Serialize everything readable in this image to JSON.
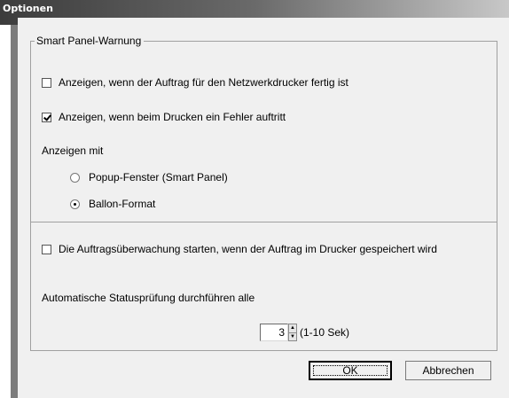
{
  "window": {
    "title": "Optionen"
  },
  "warning_group": {
    "legend": "Smart Panel-Warnung",
    "option_job_done": {
      "label": "Anzeigen, wenn der Auftrag für den Netzwerkdrucker fertig ist",
      "checked": false
    },
    "option_print_error": {
      "label": "Anzeigen, wenn beim Drucken ein Fehler auftritt",
      "checked": true
    },
    "display_with_label": "Anzeigen mit",
    "radio_popup": {
      "label": "Popup-Fenster (Smart Panel)",
      "selected": false
    },
    "radio_balloon": {
      "label": "Ballon-Format",
      "selected": true
    }
  },
  "monitoring_group": {
    "option_start_monitoring": {
      "label": "Die Auftragsüberwachung starten, wenn der Auftrag im Drucker gespeichert wird",
      "checked": false
    },
    "auto_check_label": "Automatische Statusprüfung durchführen alle",
    "interval_value": "3",
    "interval_range": "(1-10 Sek)"
  },
  "buttons": {
    "ok": "OK",
    "cancel": "Abbrechen"
  }
}
